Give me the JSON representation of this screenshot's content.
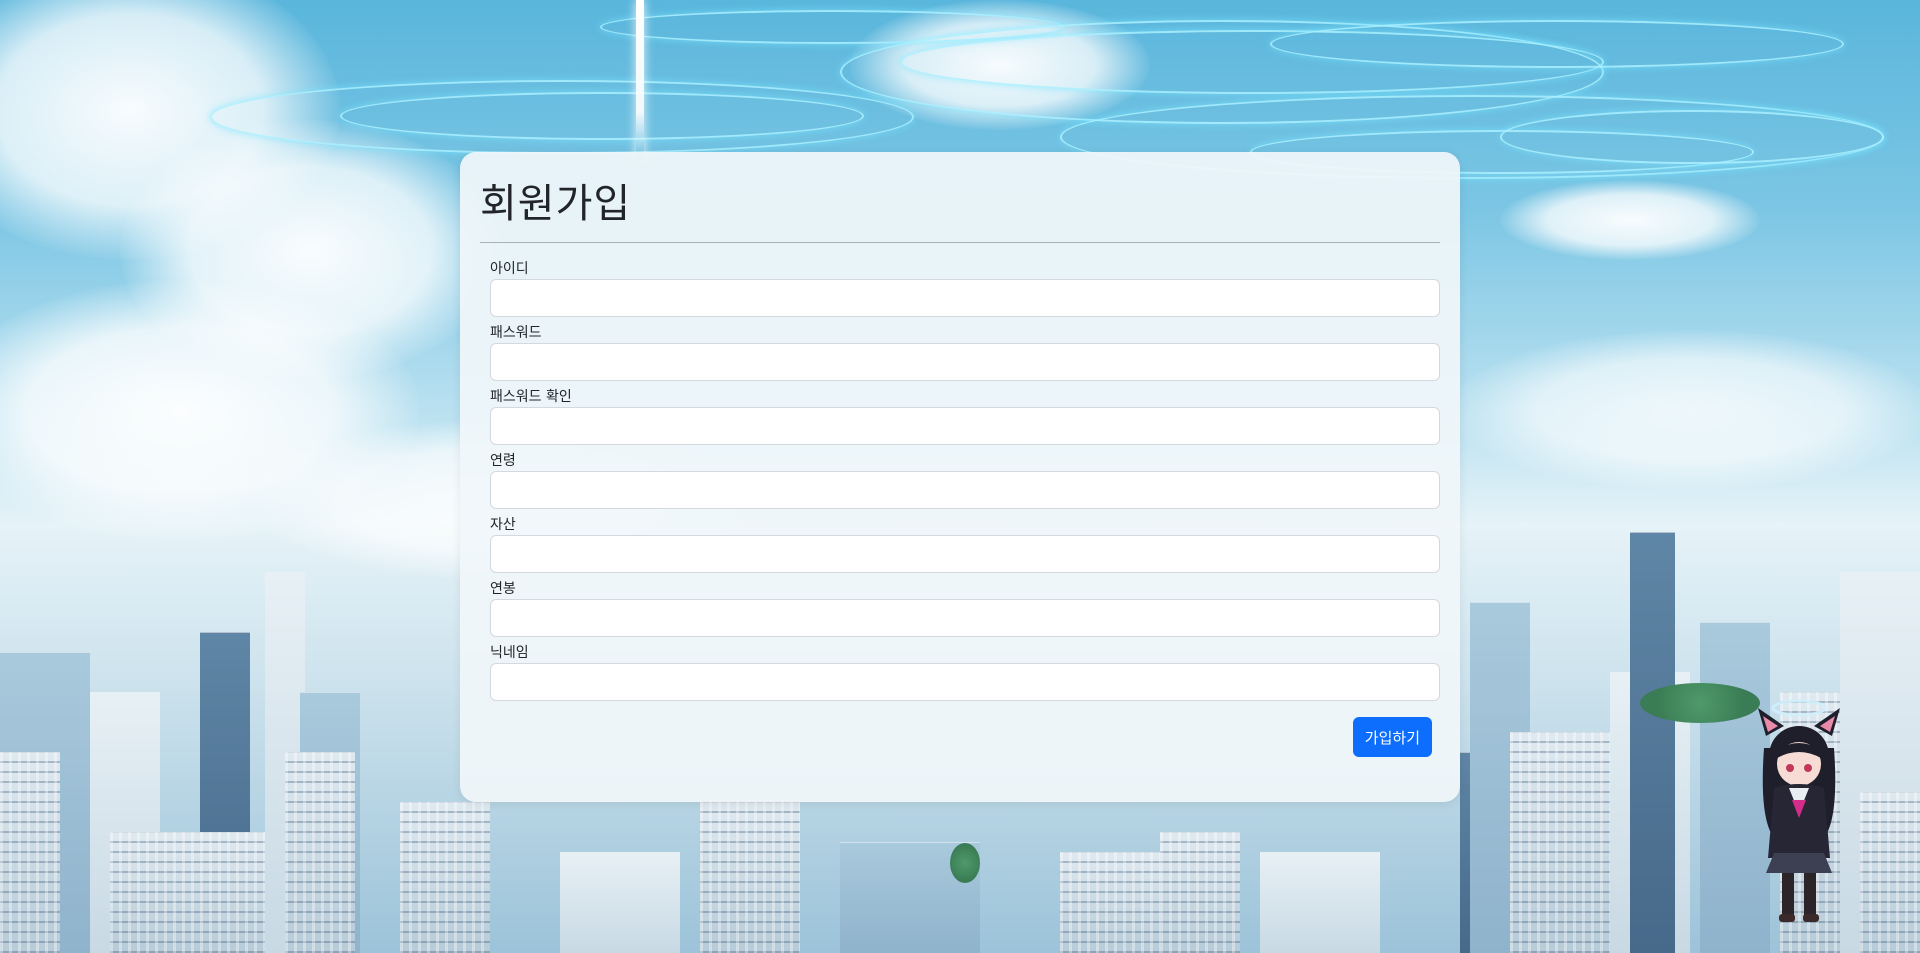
{
  "form": {
    "title": "회원가입",
    "fields": [
      {
        "label": "아이디",
        "value": ""
      },
      {
        "label": "패스워드",
        "value": ""
      },
      {
        "label": "패스워드 확인",
        "value": ""
      },
      {
        "label": "연령",
        "value": ""
      },
      {
        "label": "자산",
        "value": ""
      },
      {
        "label": "연봉",
        "value": ""
      },
      {
        "label": "닉네임",
        "value": ""
      }
    ],
    "submit_label": "가입하기"
  },
  "colors": {
    "primary_button": "#0d6efd",
    "card_background": "#f0f6fa",
    "sky": "#5ab6dc"
  },
  "background": {
    "character_icon": "chibi-cat-girl-icon"
  }
}
